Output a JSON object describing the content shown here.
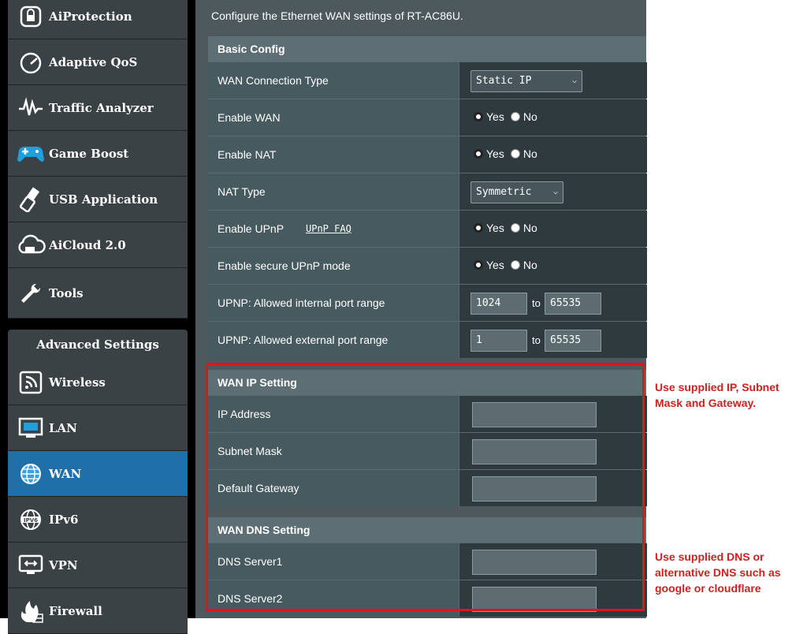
{
  "sidebar": {
    "items": [
      {
        "label": "AiProtection",
        "icon": "lock-shield-icon"
      },
      {
        "label": "Adaptive QoS",
        "icon": "speedometer-icon"
      },
      {
        "label": "Traffic Analyzer",
        "icon": "traffic-wave-icon"
      },
      {
        "label": "Game Boost",
        "icon": "gamepad-icon"
      },
      {
        "label": "USB Application",
        "icon": "usb-icon"
      },
      {
        "label": "AiCloud 2.0",
        "icon": "cloud-icon"
      },
      {
        "label": "Tools",
        "icon": "wrench-icon"
      }
    ],
    "advanced_title": "Advanced Settings",
    "advanced_items": [
      {
        "label": "Wireless",
        "icon": "wifi-icon"
      },
      {
        "label": "LAN",
        "icon": "lan-icon"
      },
      {
        "label": "WAN",
        "icon": "globe-icon",
        "active": true
      },
      {
        "label": "IPv6",
        "icon": "ipv6-globe-icon"
      },
      {
        "label": "VPN",
        "icon": "vpn-icon"
      },
      {
        "label": "Firewall",
        "icon": "fire-icon"
      }
    ]
  },
  "main": {
    "description": "Configure the Ethernet WAN settings of RT-AC86U.",
    "basic": {
      "title": "Basic Config",
      "wan_type_label": "WAN Connection Type",
      "wan_type_value": "Static IP",
      "enable_wan_label": "Enable WAN",
      "enable_nat_label": "Enable NAT",
      "nat_type_label": "NAT Type",
      "nat_type_value": "Symmetric",
      "enable_upnp_label": "Enable UPnP",
      "upnp_faq": "UPnP FAQ",
      "secure_upnp_label": "Enable secure UPnP mode",
      "int_range_label": "UPNP: Allowed internal port range",
      "int_from": "1024",
      "int_to": "65535",
      "ext_range_label": "UPNP: Allowed external port range",
      "ext_from": "1",
      "ext_to": "65535",
      "yes": "Yes",
      "no": "No",
      "to": "to"
    },
    "wan_ip": {
      "title": "WAN IP Setting",
      "ip_label": "IP Address",
      "subnet_label": "Subnet Mask",
      "gateway_label": "Default Gateway"
    },
    "wan_dns": {
      "title": "WAN DNS Setting",
      "dns1_label": "DNS Server1",
      "dns2_label": "DNS Server2"
    }
  },
  "annotations": {
    "note1_line1": "Use supplied IP, Subnet",
    "note1_line2": "Mask and Gateway.",
    "note2_line1": "Use supplied DNS or",
    "note2_line2": "alternative DNS such as",
    "note2_line3": "google or cloudflare",
    "highlight_color": "#e0141e"
  }
}
